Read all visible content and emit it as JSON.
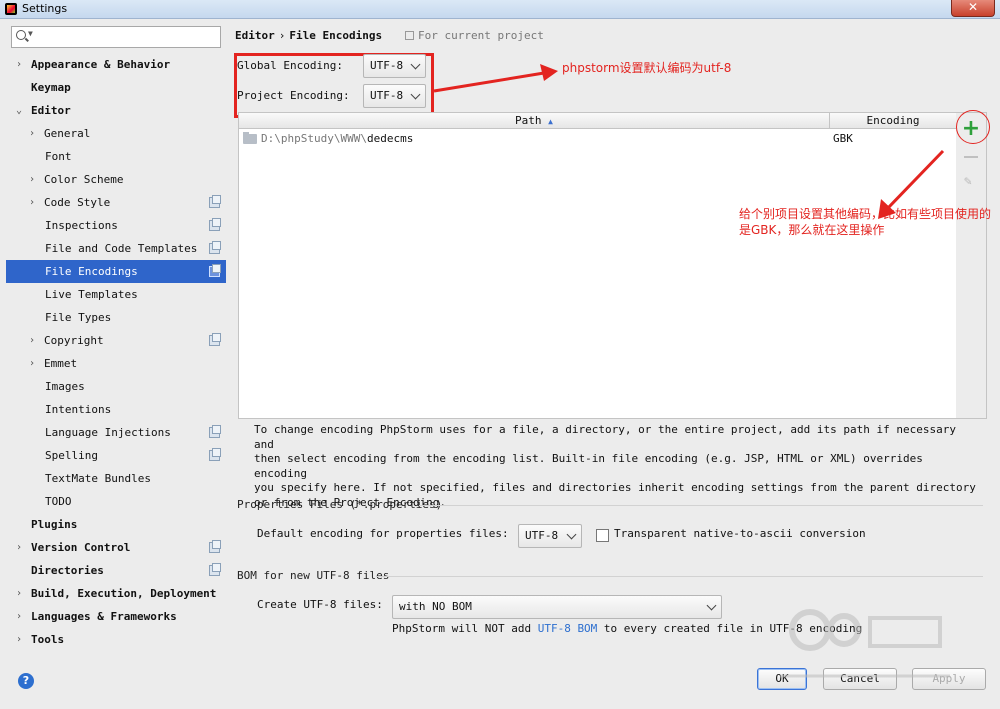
{
  "window": {
    "title": "Settings",
    "close_label": "✕"
  },
  "search": {
    "placeholder": ""
  },
  "sidebar": {
    "items": [
      {
        "label": "Appearance & Behavior"
      },
      {
        "label": "Keymap"
      },
      {
        "label": "Editor"
      },
      {
        "label": "General"
      },
      {
        "label": "Font"
      },
      {
        "label": "Color Scheme"
      },
      {
        "label": "Code Style"
      },
      {
        "label": "Inspections"
      },
      {
        "label": "File and Code Templates"
      },
      {
        "label": "File Encodings"
      },
      {
        "label": "Live Templates"
      },
      {
        "label": "File Types"
      },
      {
        "label": "Copyright"
      },
      {
        "label": "Emmet"
      },
      {
        "label": "Images"
      },
      {
        "label": "Intentions"
      },
      {
        "label": "Language Injections"
      },
      {
        "label": "Spelling"
      },
      {
        "label": "TextMate Bundles"
      },
      {
        "label": "TODO"
      },
      {
        "label": "Plugins"
      },
      {
        "label": "Version Control"
      },
      {
        "label": "Directories"
      },
      {
        "label": "Build, Execution, Deployment"
      },
      {
        "label": "Languages & Frameworks"
      },
      {
        "label": "Tools"
      }
    ]
  },
  "breadcrumb": {
    "parent": "Editor",
    "separator": "›",
    "current": "File Encodings",
    "note": "For current project"
  },
  "encodings": {
    "global_label": "Global Encoding:",
    "global_value": "UTF-8",
    "project_label": "Project Encoding:",
    "project_value": "UTF-8"
  },
  "annotations": {
    "default_encoding": "phpstorm设置默认编码为utf-8",
    "per_project": "给个别项目设置其他编码，比如有些项目使用的是GBK，那么就在这里操作"
  },
  "table": {
    "col_path": "Path",
    "sort_indicator": "▲",
    "col_encoding": "Encoding",
    "rows": [
      {
        "path_prefix": "D:\\phpStudy\\WWW\\",
        "path_name": "dedecms",
        "encoding": "GBK"
      }
    ]
  },
  "tools": {
    "add": "+",
    "edit": "✎"
  },
  "help_text": "To change encoding PhpStorm uses for a file, a directory, or the entire project, add its path if necessary and\nthen select encoding from the encoding list. Built-in file encoding (e.g. JSP, HTML or XML) overrides encoding\nyou specify here. If not specified, files and directories inherit encoding settings from the parent directory\nor from the Project Encoding.",
  "properties": {
    "section_title": "Properties Files (*.properties)",
    "default_label": "Default encoding for properties files:",
    "default_value": "UTF-8",
    "transparent_label": "Transparent native-to-ascii conversion",
    "transparent_checked": false
  },
  "bom": {
    "section_title": "BOM for new UTF-8 files",
    "create_label": "Create UTF-8 files:",
    "create_value": "with NO BOM",
    "note_before": "PhpStorm will NOT add ",
    "note_link": "UTF-8 BOM",
    "note_after": " to every created file in UTF-8 encoding"
  },
  "buttons": {
    "help": "?",
    "ok": "OK",
    "cancel": "Cancel",
    "apply": "Apply"
  }
}
